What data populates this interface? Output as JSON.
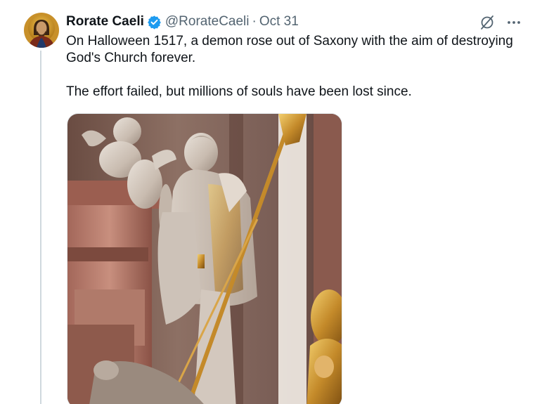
{
  "author": {
    "name": "Rorate Caeli",
    "handle": "@RorateCaeli",
    "separator": "·",
    "date": "Oct 31",
    "verified": true,
    "avatar_icon": "icon-christ-avatar"
  },
  "tweet": {
    "paragraphs": [
      "On Halloween 1517, a demon rose out of Saxony with the aim of destroying God's Church forever.",
      "The effort failed, but millions of souls have been lost since."
    ]
  },
  "actions": {
    "grok_icon": "grok-icon",
    "more_icon": "more-icon"
  },
  "colors": {
    "text": "#0f1419",
    "muted": "#536471",
    "verified": "#1d9bf0",
    "thread_line": "#cfd9de"
  },
  "media": {
    "type": "photo",
    "subject": "statue-image"
  }
}
